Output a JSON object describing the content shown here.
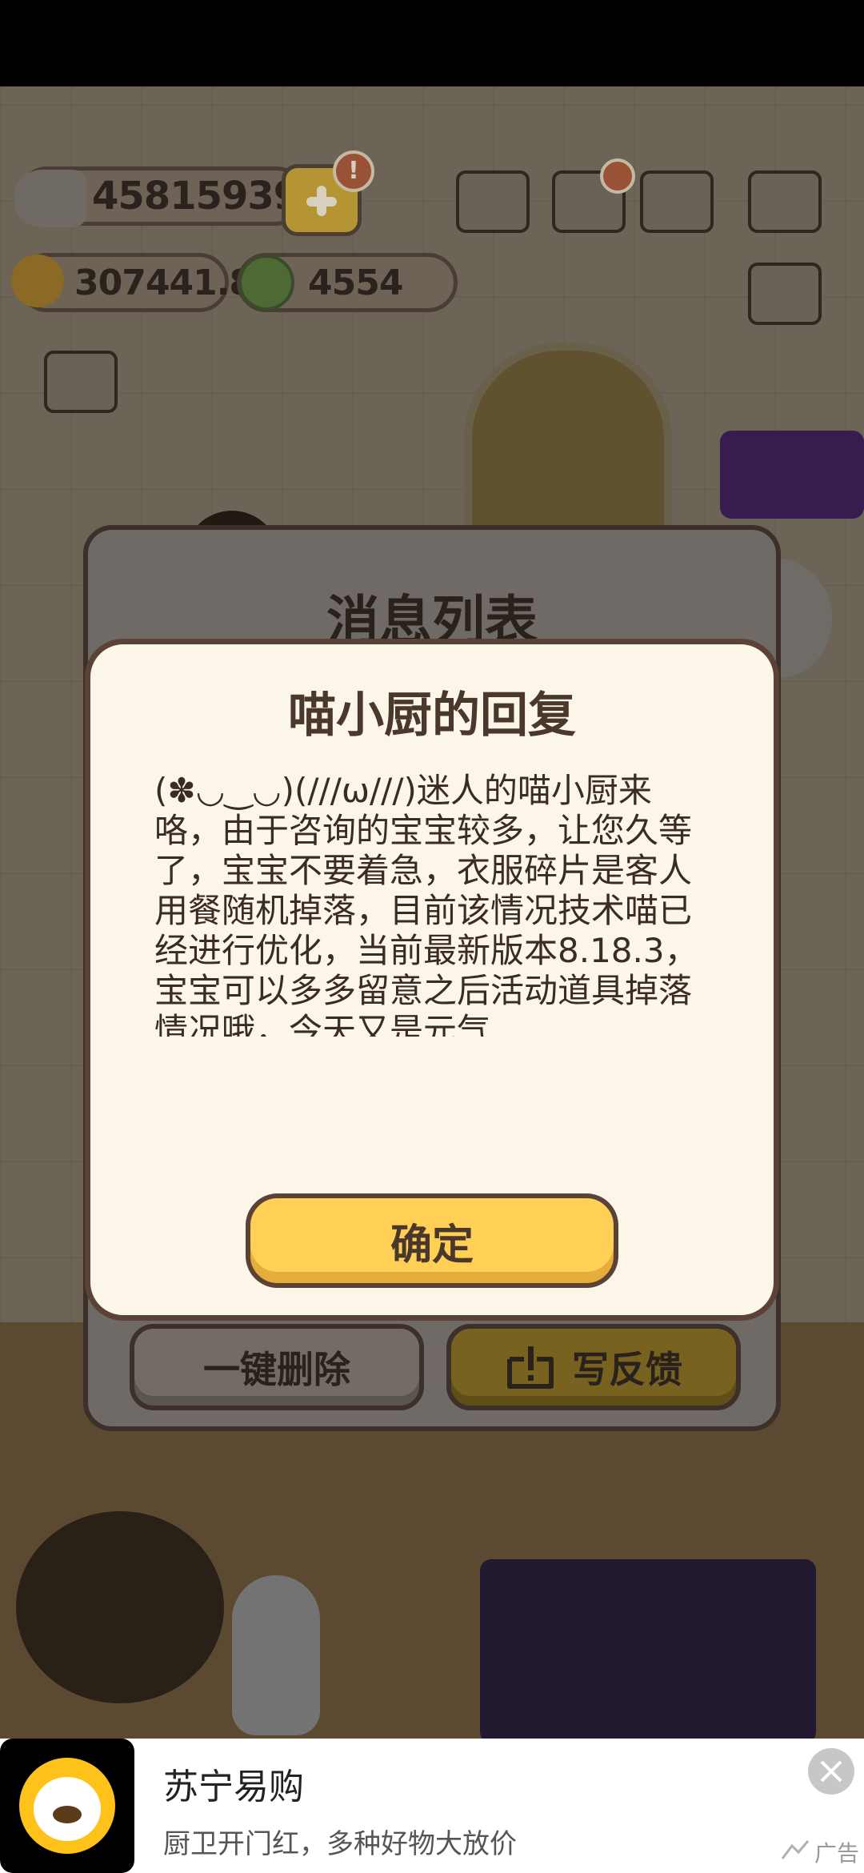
{
  "currency": {
    "fish": "45815939",
    "stars": "307441.8",
    "coins": "4554",
    "alert": "!"
  },
  "message_list": {
    "title": "消息列表",
    "delete_all": "一键删除",
    "write_feedback": "写反馈"
  },
  "reply_dialog": {
    "title": "喵小厨的回复",
    "body": "(✽◡‿◡)(///ω///)迷人的喵小厨来咯，由于咨询的宝宝较多，让您久等了，宝宝不要着急，衣服碎片是客人用餐随机掉落，目前该情况技术喵已经进行优化，当前最新版本8.18.3，宝宝可以多多留意之后活动道具掉落情况哦，今天又是元气",
    "confirm": "确定"
  },
  "ad": {
    "title": "苏宁易购",
    "description": "厨卫开门红，多种好物大放价",
    "tag": "广告"
  }
}
